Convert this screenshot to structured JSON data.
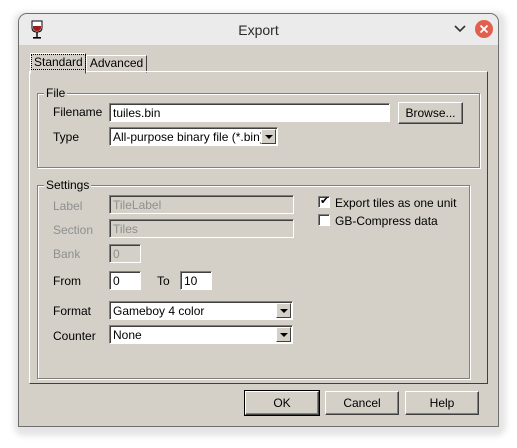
{
  "window": {
    "title": "Export"
  },
  "tabs": [
    {
      "label": "Standard",
      "selected": true
    },
    {
      "label": "Advanced",
      "selected": false
    }
  ],
  "file": {
    "group_label": "File",
    "filename_label": "Filename",
    "filename_value": "tuiles.bin",
    "browse_label": "Browse...",
    "type_label": "Type",
    "type_value": "All-purpose binary file (*.bin)"
  },
  "settings": {
    "group_label": "Settings",
    "label_label": "Label",
    "label_value": "TileLabel",
    "section_label": "Section",
    "section_value": "Tiles",
    "bank_label": "Bank",
    "bank_value": "0",
    "from_label": "From",
    "from_value": "0",
    "to_label": "To",
    "to_value": "10",
    "format_label": "Format",
    "format_value": "Gameboy 4 color",
    "counter_label": "Counter",
    "counter_value": "None",
    "export_one_unit_label": "Export tiles as one unit",
    "export_one_unit_checked": true,
    "gb_compress_label": "GB-Compress data",
    "gb_compress_checked": false
  },
  "buttons": {
    "ok": "OK",
    "cancel": "Cancel",
    "help": "Help"
  },
  "colors": {
    "close": "#e35f4d",
    "dialog": "#d4d0c8"
  }
}
